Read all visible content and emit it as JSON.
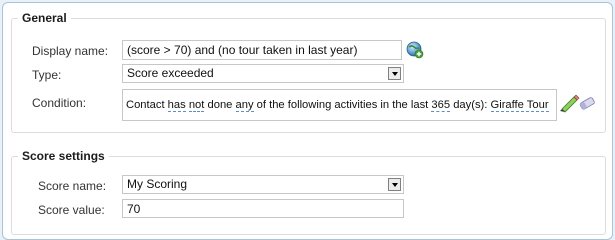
{
  "general": {
    "legend": "General",
    "display_name_label": "Display name:",
    "display_name_value": "(score > 70) and (no tour taken in last year)",
    "type_label": "Type:",
    "type_value": "Score exceeded",
    "condition_label": "Condition:",
    "condition": {
      "t1": "Contact",
      "k1": "has",
      "k2": "not",
      "t2": "done",
      "k3": "any",
      "t3": "of the following activities in the last",
      "k4": "365",
      "t4": "day(s):",
      "k5": "Giraffe Tour"
    }
  },
  "score_settings": {
    "legend": "Score settings",
    "score_name_label": "Score name:",
    "score_name_value": "My Scoring",
    "score_value_label": "Score value:",
    "score_value_value": "70"
  },
  "icons": {
    "add_macro": "add-globe-icon",
    "edit_condition": "edit-pencil-icon"
  }
}
